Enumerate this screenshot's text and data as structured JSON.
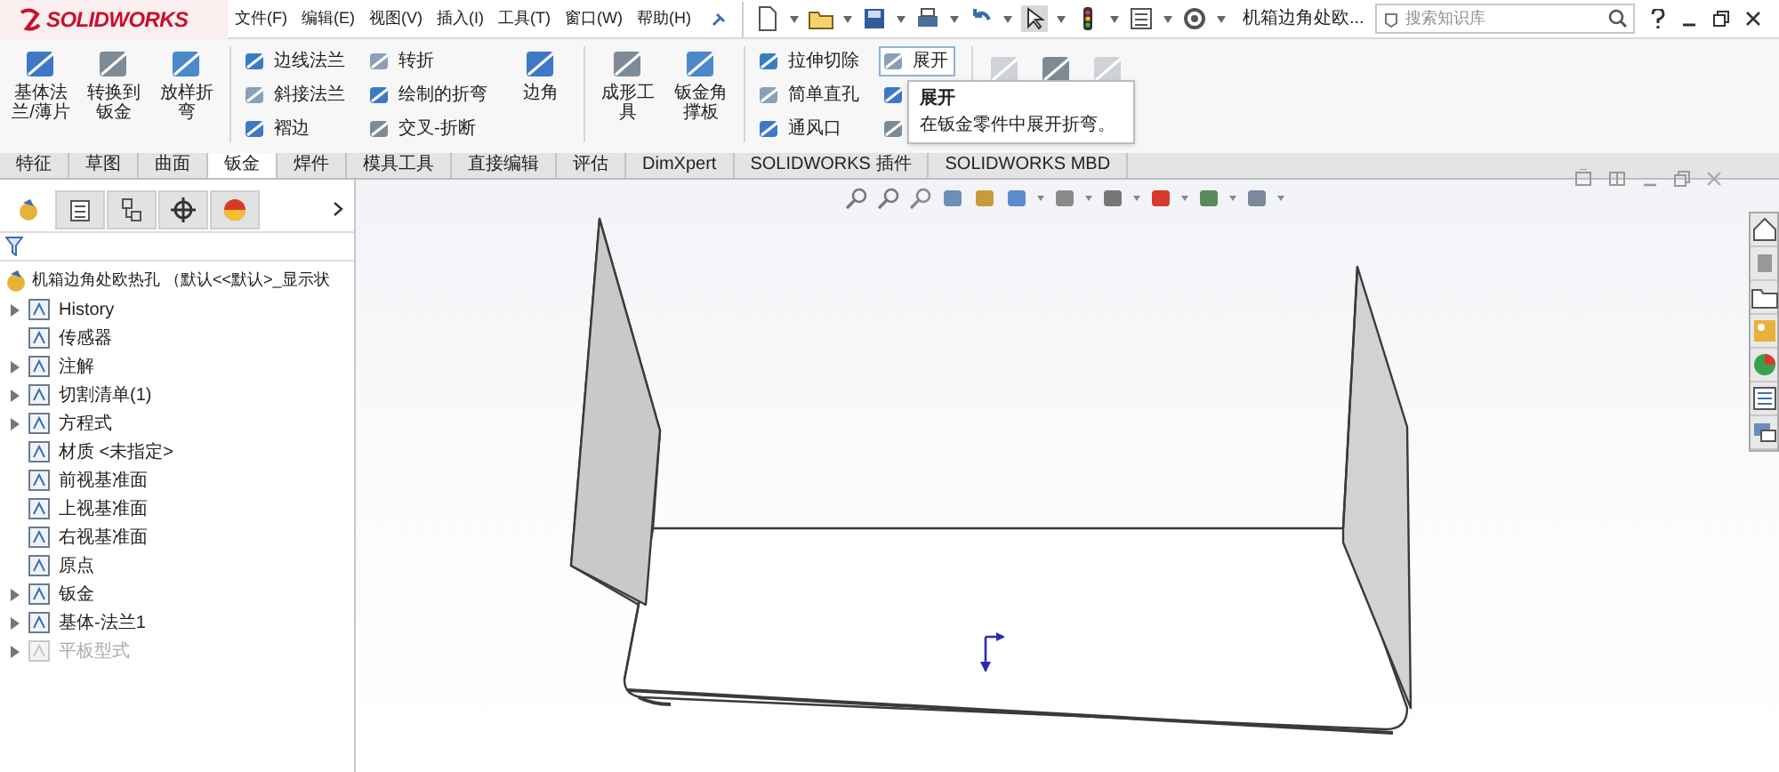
{
  "app": {
    "logo": "SOLIDWORKS"
  },
  "menu": [
    "文件(F)",
    "编辑(E)",
    "视图(V)",
    "插入(I)",
    "工具(T)",
    "窗口(W)",
    "帮助(H)"
  ],
  "document_title": "机箱边角处欧...",
  "search": {
    "placeholder": "搜索知识库"
  },
  "ribbon": [
    {
      "kind": "large",
      "label": "基体法兰/薄片"
    },
    {
      "kind": "large",
      "label": "转换到钣金"
    },
    {
      "kind": "large",
      "label": "放样折弯"
    },
    {
      "kind": "stack",
      "items": [
        {
          "label": "边线法兰",
          "highlighted": false
        },
        {
          "label": "斜接法兰",
          "highlighted": false
        },
        {
          "label": "褶边",
          "highlighted": false
        }
      ]
    },
    {
      "kind": "stack",
      "items": [
        {
          "label": "转折",
          "highlighted": false
        },
        {
          "label": "绘制的折弯",
          "highlighted": false
        },
        {
          "label": "交叉-折断",
          "highlighted": false
        }
      ]
    },
    {
      "kind": "large",
      "label": "边角"
    },
    {
      "kind": "large",
      "label": "成形工具"
    },
    {
      "kind": "large",
      "label": "钣金角撑板"
    },
    {
      "kind": "stack",
      "items": [
        {
          "label": "拉伸切除",
          "highlighted": false
        },
        {
          "label": "简单直孔",
          "highlighted": false
        },
        {
          "label": "通风口",
          "highlighted": false
        }
      ]
    },
    {
      "kind": "stack",
      "items": [
        {
          "label": "展开",
          "highlighted": true
        },
        {
          "highlighted": false
        },
        {
          "highlighted": false
        }
      ]
    },
    {
      "kind": "icon",
      "disabled": true
    },
    {
      "kind": "icon",
      "disabled": false
    },
    {
      "kind": "icon",
      "disabled": true
    }
  ],
  "tooltip": {
    "title": "展开",
    "text": "在钣金零件中展开折弯。"
  },
  "tabs": [
    {
      "label": "特征",
      "selected": false
    },
    {
      "label": "草图",
      "selected": false
    },
    {
      "label": "曲面",
      "selected": false
    },
    {
      "label": "钣金",
      "selected": true
    },
    {
      "label": "焊件",
      "selected": false
    },
    {
      "label": "模具工具",
      "selected": false
    },
    {
      "label": "直接编辑",
      "selected": false
    },
    {
      "label": "评估",
      "selected": false
    },
    {
      "label": "DimXpert",
      "selected": false
    },
    {
      "label": "SOLIDWORKS 插件",
      "selected": false
    },
    {
      "label": "SOLIDWORKS MBD",
      "selected": false
    }
  ],
  "panel_tabs": [
    {
      "selected": true
    },
    {
      "selected": false
    },
    {
      "selected": false
    },
    {
      "selected": false
    },
    {
      "selected": false
    }
  ],
  "feature_tree": {
    "root": "机箱边角处欧热孔 （默认<<默认>_显示状",
    "items": [
      {
        "label": "History",
        "expandable": true,
        "disabled": false
      },
      {
        "label": "传感器",
        "expandable": false,
        "disabled": false
      },
      {
        "label": "注解",
        "expandable": true,
        "disabled": false
      },
      {
        "label": "切割清单(1)",
        "expandable": true,
        "disabled": false
      },
      {
        "label": "方程式",
        "expandable": true,
        "disabled": false
      },
      {
        "label": "材质 <未指定>",
        "expandable": false,
        "disabled": false
      },
      {
        "label": "前视基准面",
        "expandable": false,
        "disabled": false
      },
      {
        "label": "上视基准面",
        "expandable": false,
        "disabled": false
      },
      {
        "label": "右视基准面",
        "expandable": false,
        "disabled": false
      },
      {
        "label": "原点",
        "expandable": false,
        "disabled": false
      },
      {
        "label": "钣金",
        "expandable": true,
        "disabled": false
      },
      {
        "label": "基体-法兰1",
        "expandable": true,
        "disabled": false
      },
      {
        "label": "平板型式",
        "expandable": true,
        "disabled": true
      }
    ]
  }
}
